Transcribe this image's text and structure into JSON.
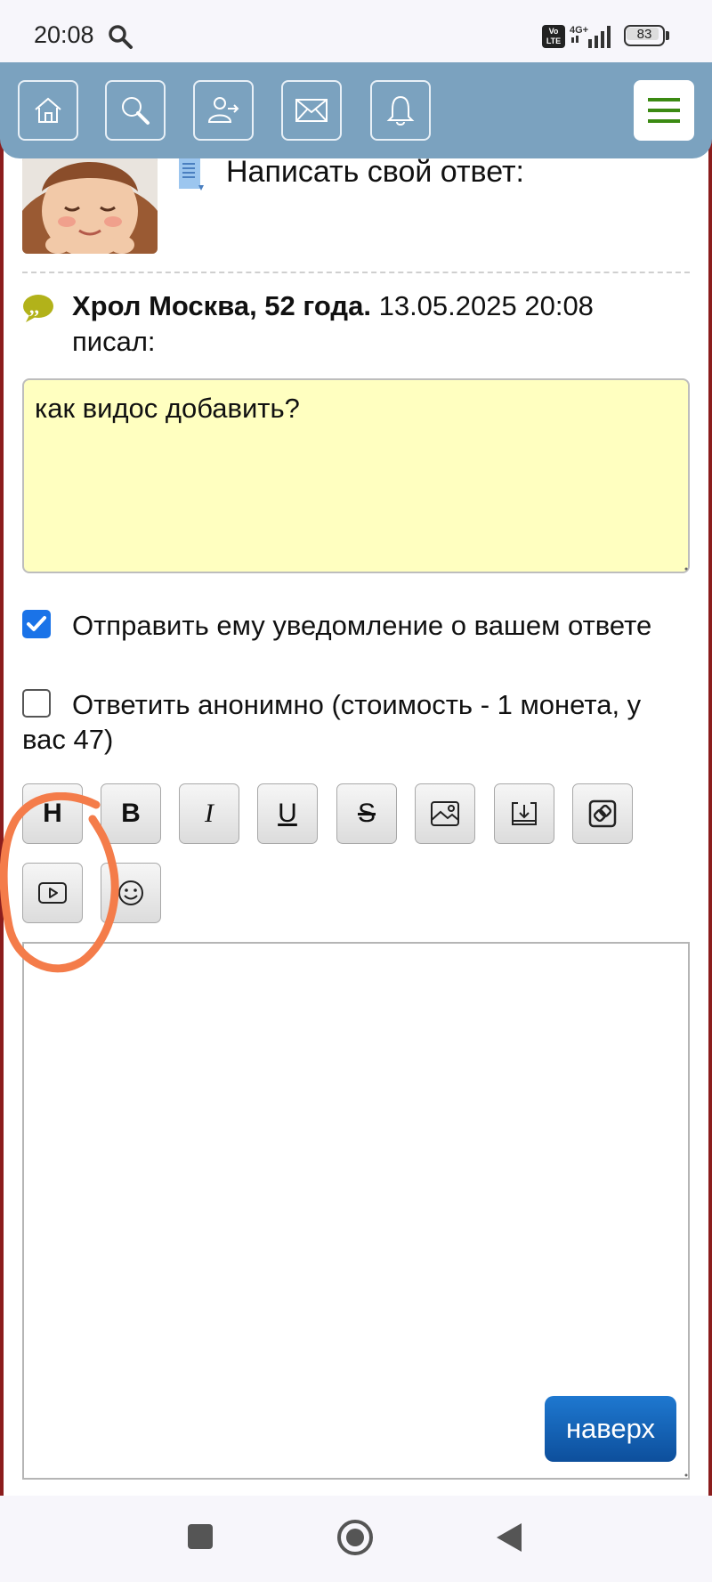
{
  "status": {
    "time": "20:08",
    "volte_label": "Vo LTE",
    "network": "4G+",
    "battery": "83"
  },
  "nav": {
    "icons": [
      "home-icon",
      "search-icon",
      "logout-icon",
      "mail-icon",
      "bell-icon"
    ],
    "menu_icon": "hamburger-menu-icon"
  },
  "reply": {
    "title": "Написать свой ответ:"
  },
  "quote": {
    "author": "Хрол Москва, 52 года.",
    "datetime": " 13.05.2025 20:08",
    "wrote": "писал:",
    "text": "как видос добавить?"
  },
  "options": {
    "notify": {
      "label": "Отправить ему уведомление о вашем ответе",
      "checked": true
    },
    "anonymous": {
      "label": "Ответить анонимно (стоимость - 1 монета, у",
      "label_cont": "вас 47)",
      "checked": false
    }
  },
  "toolbar": {
    "heading": "H",
    "bold": "B",
    "italic": "I",
    "underline": "U",
    "strike": "S"
  },
  "editor": {
    "value": "",
    "top_button": "наверх"
  },
  "colors": {
    "nav_bg": "#7ba2bf",
    "page_border": "#8b1d1d",
    "quote_bg": "#ffffc0",
    "checkbox": "#1a73e8",
    "top_button": "#1565c0",
    "annotation": "#f47c4a"
  }
}
